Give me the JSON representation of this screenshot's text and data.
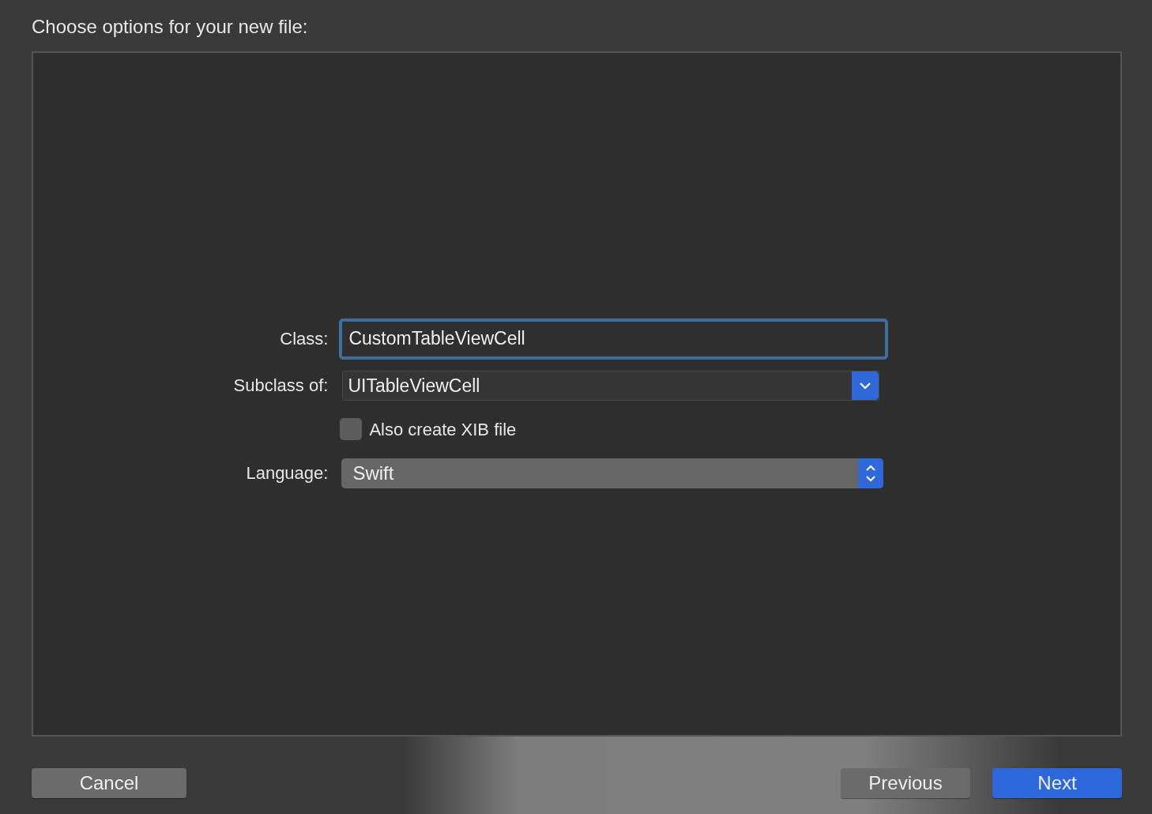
{
  "title": "Choose options for your new file:",
  "fields": [
    {
      "kind": "text",
      "label": "Class:",
      "value": "CustomTableViewCell",
      "focused": true
    },
    {
      "kind": "popup",
      "label": "Subclass of:",
      "value": "UITableViewCell"
    },
    {
      "kind": "checkbox",
      "label": "Also create XIB file",
      "checked": false
    },
    {
      "kind": "stepper",
      "label": "Language:",
      "value": "Swift"
    }
  ],
  "buttons_left": [
    {
      "label": "Cancel",
      "default": false
    }
  ],
  "buttons_right": [
    {
      "label": "Previous",
      "default": false
    },
    {
      "label": "Next",
      "default": true
    }
  ]
}
